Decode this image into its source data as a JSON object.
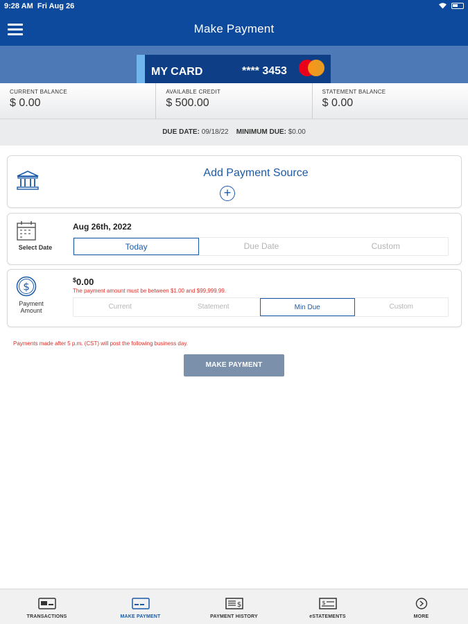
{
  "status_bar": {
    "time": "9:28 AM",
    "date": "Fri Aug 26"
  },
  "header": {
    "title": "Make Payment"
  },
  "card": {
    "name": "MY CARD",
    "masked_number": "**** 3453"
  },
  "balances": [
    {
      "label": "CURRENT BALANCE",
      "value": "$ 0.00"
    },
    {
      "label": "AVAILABLE CREDIT",
      "value": "$ 500.00"
    },
    {
      "label": "STATEMENT BALANCE",
      "value": "$ 0.00"
    }
  ],
  "due": {
    "due_label": "DUE DATE:",
    "due_value": "09/18/22",
    "min_label": "MINIMUM DUE:",
    "min_value": "$0.00"
  },
  "payment_source": {
    "title": "Add Payment Source",
    "plus": "+"
  },
  "date_section": {
    "label": "Select Date",
    "selected_date": "Aug 26th, 2022",
    "options": [
      "Today",
      "Due Date",
      "Custom"
    ]
  },
  "amount_section": {
    "label_line1": "Payment",
    "label_line2": "Amount",
    "currency": "$",
    "amount": "0.00",
    "error": "The payment amount must be between $1.00 and $99,999.99.",
    "options": [
      "Current",
      "Statement",
      "Min Due",
      "Custom"
    ]
  },
  "notice": "Payments made after 5 p.m. (CST) will post the following business day.",
  "make_payment_button": "MAKE PAYMENT",
  "bottom_nav": [
    {
      "label": "TRANSACTIONS",
      "icon": "card-icon"
    },
    {
      "label": "MAKE PAYMENT",
      "icon": "payment-icon"
    },
    {
      "label": "PAYMENT HISTORY",
      "icon": "history-icon"
    },
    {
      "label": "eSTATEMENTS",
      "icon": "statement-icon"
    },
    {
      "label": "MORE",
      "icon": "chevron-right-icon"
    }
  ],
  "colors": {
    "header_blue": "#0d4a9e",
    "accent": "#1a5aa8",
    "error": "#d9312b",
    "button": "#7b90aa"
  }
}
